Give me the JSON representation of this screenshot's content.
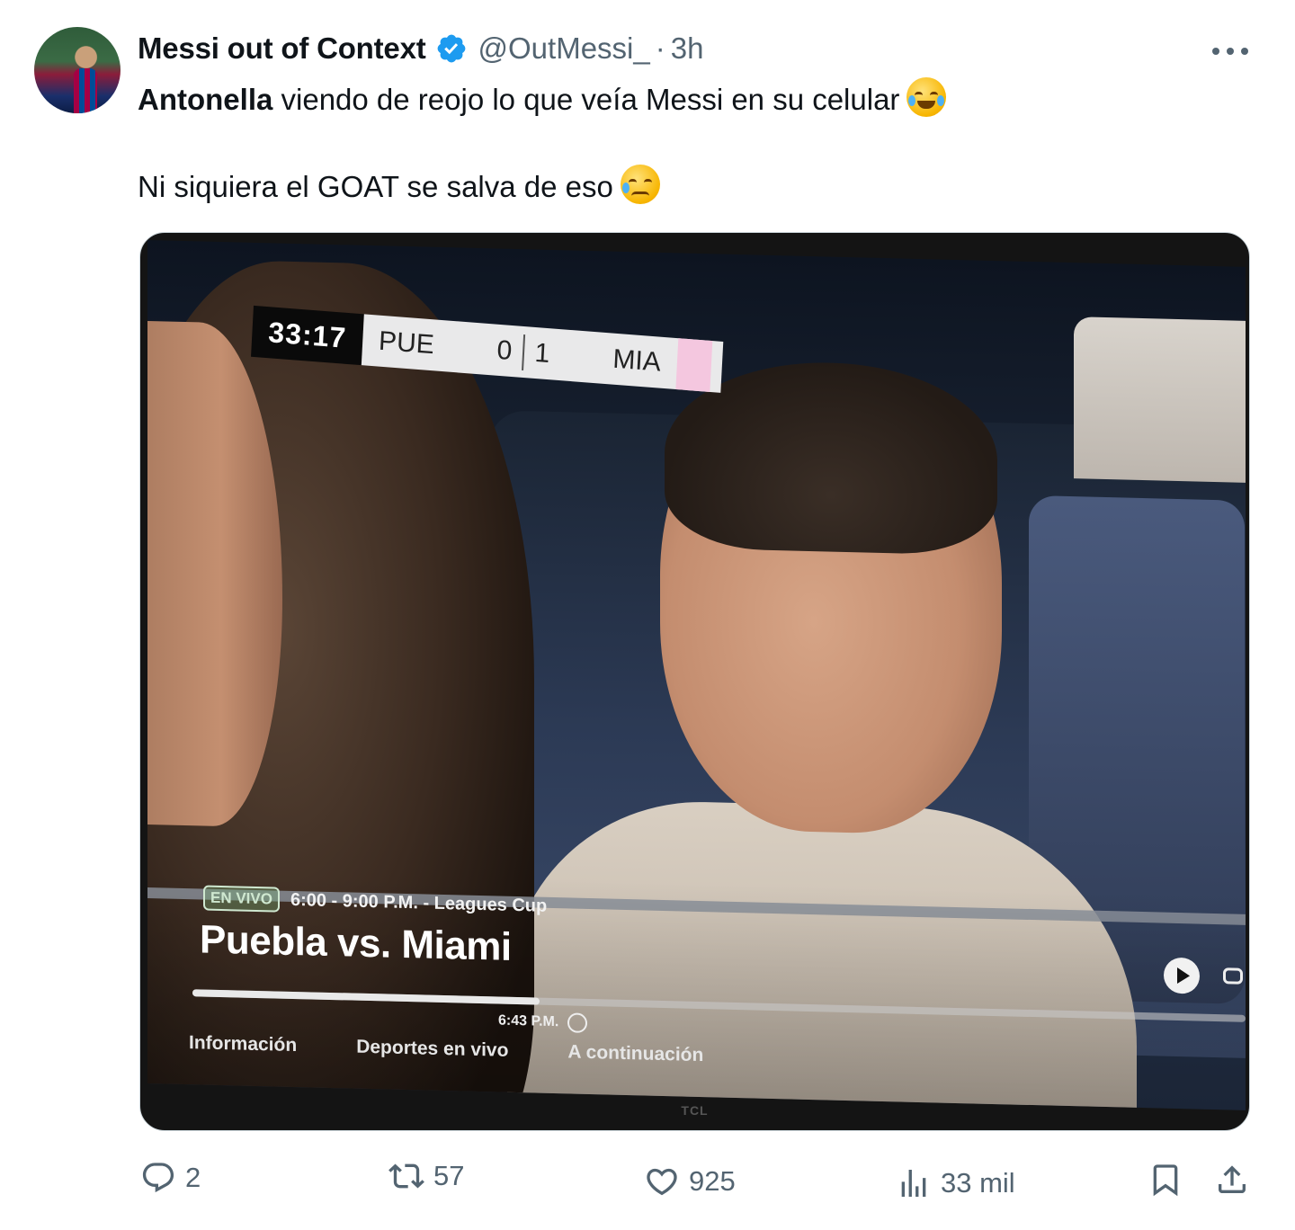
{
  "author": {
    "display_name": "Messi out of Context",
    "handle": "@OutMessi_",
    "separator": "·",
    "time": "3h",
    "verified": true
  },
  "tweet": {
    "line1_bold": "Antonella",
    "line1_rest": " viendo de reojo lo que veía Messi en su celular",
    "line1_emoji": "rolling-on-floor-laughing-emoji",
    "line2": "Ni siquiera el GOAT se salva de eso",
    "line2_emoji": "sad-tear-emoji"
  },
  "media": {
    "scoreboard": {
      "clock": "33:17",
      "home_team": "PUE",
      "home_score": "0",
      "away_score": "1",
      "away_team": "MIA"
    },
    "tv_overlay": {
      "live_badge": "EN VIVO",
      "schedule": "6:00 - 9:00 P.M. - Leagues Cup",
      "program_title": "Puebla vs. Miami",
      "progress_fraction": 0.33,
      "current_time": "6:43 P.M.",
      "nav": [
        "Información",
        "Deportes en vivo",
        "A continuación"
      ]
    },
    "tv_brand": "TCL"
  },
  "actions": {
    "replies": "2",
    "reposts": "57",
    "likes": "925",
    "views": "33 mil"
  },
  "colors": {
    "text_primary": "#0f1419",
    "text_secondary": "#536471",
    "verified_blue": "#1d9bf0",
    "border": "#cfd9de"
  },
  "icons": [
    "more-icon",
    "verified-icon",
    "reply-icon",
    "repost-icon",
    "like-icon",
    "views-icon",
    "bookmark-icon",
    "share-icon"
  ]
}
